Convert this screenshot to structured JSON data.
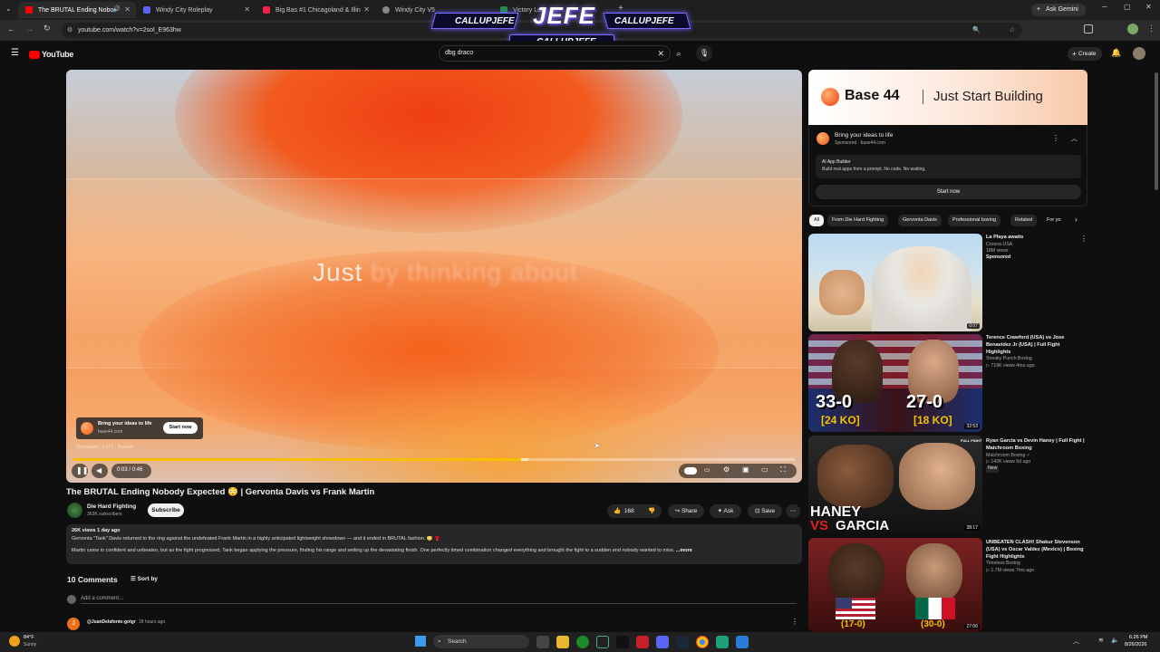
{
  "browser": {
    "tabs": [
      {
        "title": "The BRUTAL Ending Nobo",
        "active": true
      },
      {
        "title": "Windy City Roleplay"
      },
      {
        "title": "Big Bas #1 Chicagoland & Illin"
      },
      {
        "title": "Windy City V5"
      },
      {
        "title": "Victory Lo"
      }
    ],
    "ask_gemini": "Ask Gemini",
    "url": "youtube.com/watch?v=2sol_E963hw"
  },
  "stream_overlay": {
    "handle_left": "CALLUPJEFE",
    "logo": "JEFE",
    "handle_right": "CALLUPJEFE",
    "handle_bottom": "CALLUPJEFE"
  },
  "youtube": {
    "logo": "YouTube",
    "search_value": "dbg draco",
    "create_label": "Create"
  },
  "player": {
    "overlay_text_main": "Just",
    "overlay_text_faded": "by thinking about",
    "ad_card": {
      "title": "Bring your ideas to life",
      "domain": "base44.com",
      "cta": "Start now",
      "sponsored": "Sponsored · 1 of 2 · Base44"
    },
    "time": "0:03 / 0:46",
    "played_fraction": 0.62
  },
  "video": {
    "title": "The BRUTAL Ending Nobody Expected 😳 | Gervonta Davis vs Frank Martin",
    "channel": "Die Hard Fighting",
    "subscribers": "363K subscribers",
    "subscribe_label": "Subscribe",
    "likes": "168",
    "share_label": "Share",
    "ask_label": "Ask",
    "save_label": "Save",
    "stats": "26K views  1 day ago",
    "desc_line1": "Gervonta \"Tank\" Davis returned to the ring against the undefeated Frank Martin in a highly anticipated lightweight showdown — and it ended in BRUTAL fashion. 😳 🥊",
    "desc_line2": "Martin came in confident and unbeaten, but as the fight progressed, Tank began applying the pressure, finding his range and setting up the devastating finish. One perfectly timed combination changed everything and brought the fight to a sudden end nobody wanted to miss.",
    "more_label": "...more"
  },
  "comments": {
    "count_label": "10 Comments",
    "sort_label": "Sort by",
    "add_placeholder": "Add a comment...",
    "first_author": "@JuanDelafonte-gotgr",
    "first_time": "18 hours ago"
  },
  "sidebar_ad": {
    "brand": "Base 44",
    "tagline": "Just Start Building",
    "title": "Bring your ideas to life",
    "sponsor_line": "Sponsored · base44.com",
    "product": "AI App Builder",
    "product_desc": "Build real apps from a prompt. No code. No waiting.",
    "cta": "Start now"
  },
  "chips": [
    "All",
    "From Die Hard Fighting",
    "Gervonta Davis",
    "Professional boxing",
    "Related",
    "For yo"
  ],
  "recommendations": [
    {
      "title": "La Playa awaits",
      "line1": "Corona USA",
      "line2": "18M views",
      "line3": "Sponsored",
      "duration": "0:07"
    },
    {
      "title": "Terence Crawford (USA) vs Jose Benavidez Jr (USA) | Full Fight Highlights",
      "line1": "Sneaky Punch Boxing",
      "line2": "▷ 719K views  4mo ago",
      "line3": "",
      "duration": "32:53",
      "thumb_left": "33-0",
      "thumb_left_sub": "[24 KO]",
      "thumb_right": "27-0",
      "thumb_right_sub": "[18 KO]"
    },
    {
      "title": "Ryan Garcia vs Devin Haney | Full Fight | Matchroom Boxing",
      "line1": "Matchroom Boxing ✓",
      "line2": "▷ 142K views  5d ago",
      "line3": "New",
      "duration": "38:17",
      "thumb_text1": "HANEY",
      "thumb_text2": "VS",
      "thumb_text3": "GARCIA",
      "thumb_tag": "FULL FIGHT"
    },
    {
      "title": "UNBEATEN CLASH! Shakur Stevenson (USA) vs Oscar Valdez (Mexico) | Boxing Fight Highlights",
      "line1": "Timeless Boxing",
      "line2": "▷ 1.7M views  7mo ago",
      "line3": "",
      "duration": "27:06",
      "thumb_left": "(17-0)",
      "thumb_right": "(30-0)"
    }
  ],
  "taskbar": {
    "weather_temp": "84°F",
    "weather_cond": "Sunny",
    "search_label": "Search",
    "time": "6:26 PM",
    "date": "8/26/2026"
  }
}
